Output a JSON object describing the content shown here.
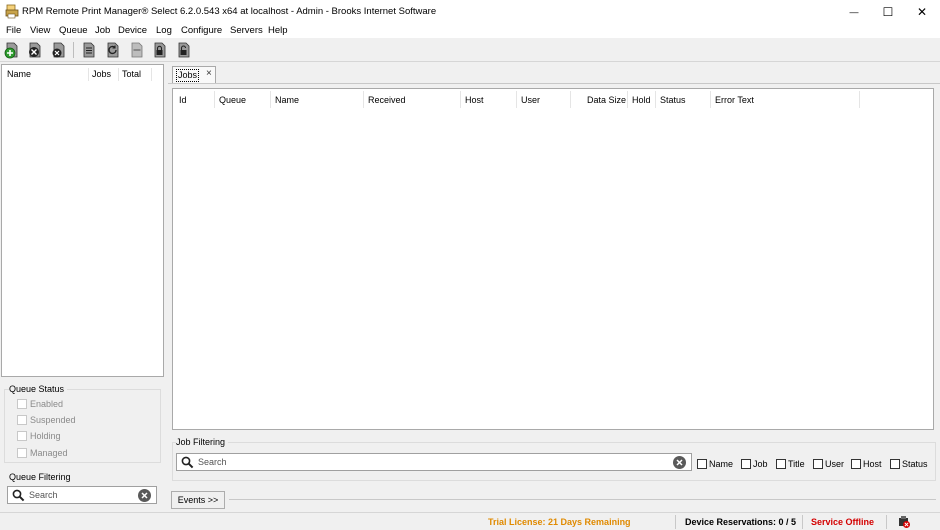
{
  "window": {
    "title": "RPM Remote Print Manager® Select 6.2.0.543 x64 at localhost - Admin - Brooks Internet Software",
    "minimize_glyph": "—",
    "maximize_glyph": "☐",
    "close_glyph": "✕"
  },
  "menu": [
    "File",
    "View",
    "Queue",
    "Job",
    "Device",
    "Log",
    "Configure",
    "Servers",
    "Help"
  ],
  "toolbar": {
    "icons": [
      "add-queue-icon",
      "delete-queue-icon",
      "cancel-queue-icon",
      "queue-jobs-icon",
      "restart-icon",
      "pause-icon",
      "lock-queue-icon",
      "unlock-queue-icon"
    ]
  },
  "queue_list": {
    "columns": [
      "Name",
      "Jobs",
      "Total"
    ]
  },
  "queue_status": {
    "title": "Queue Status",
    "options": [
      "Enabled",
      "Suspended",
      "Holding",
      "Managed"
    ]
  },
  "queue_filtering": {
    "title": "Queue Filtering",
    "placeholder": "Search"
  },
  "tabs": [
    {
      "label": "Jobs",
      "close_glyph": "×"
    }
  ],
  "jobs_grid": {
    "columns": [
      "Id",
      "Queue",
      "Name",
      "Received",
      "Host",
      "User",
      "Data Size",
      "Hold",
      "Status",
      "Error Text"
    ],
    "rows": []
  },
  "job_filtering": {
    "title": "Job Filtering",
    "placeholder": "Search",
    "options": [
      "Name",
      "Job",
      "Title",
      "User",
      "Host",
      "Status"
    ]
  },
  "events_button": "Events >>",
  "status_bar": {
    "license": "Trial License: 21 Days Remaining",
    "reservations": "Device Reservations: 0 / 5",
    "service": "Service Offline"
  },
  "colors": {
    "license": "#e08a00",
    "service_offline": "#d40000"
  }
}
